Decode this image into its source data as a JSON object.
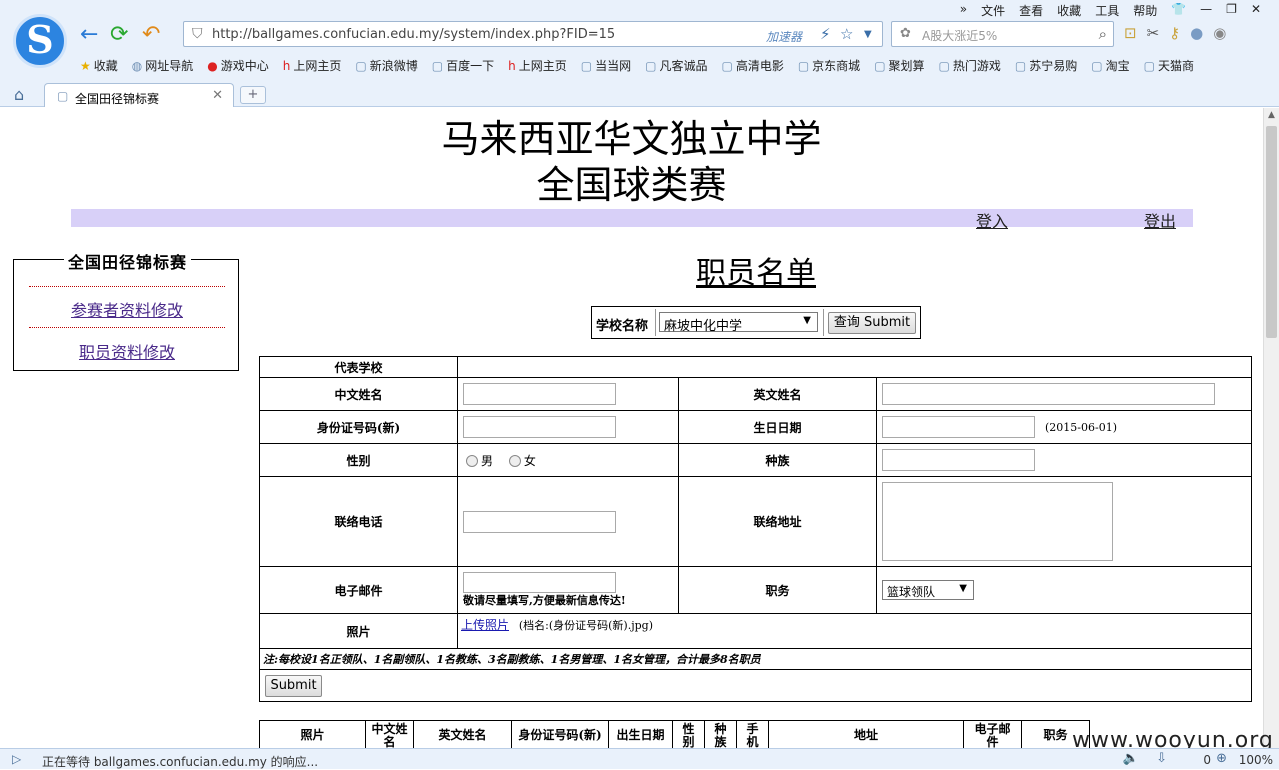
{
  "browser": {
    "menu": [
      "»",
      "文件",
      "查看",
      "收藏",
      "工具",
      "帮助",
      "👕",
      "—",
      "❐",
      "✕"
    ],
    "url": "http://ballgames.confucian.edu.my/system/index.php?FID=15",
    "accelerator": "加速器",
    "search_placeholder": "A股大涨近5%",
    "bookmarks": [
      "收藏",
      "网址导航",
      "游戏中心",
      "上网主页",
      "新浪微博",
      "百度一下",
      "上网主页",
      "当当网",
      "凡客诚品",
      "高清电影",
      "京东商城",
      "聚划算",
      "热门游戏",
      "苏宁易购",
      "淘宝",
      "天猫商"
    ],
    "tab_title": "全国田径锦标赛",
    "status_text": "正在等待 ballgames.confucian.edu.my 的响应...",
    "zoom": "100%",
    "status_count": "0"
  },
  "header": {
    "title_line1": "马来西亚华文独立中学",
    "title_line2": "全国球类赛",
    "login": "登入",
    "logout": "登出"
  },
  "sidebar": {
    "legend": "全国田径锦标赛",
    "links": [
      "参赛者资料修改",
      "职员资料修改"
    ]
  },
  "main": {
    "title": "职员名单",
    "school_label": "学校名称",
    "school_value": "麻坡中化中学",
    "query_button": "查询 Submit"
  },
  "form": {
    "rep_school": "代表学校",
    "chinese_name": "中文姓名",
    "english_name": "英文姓名",
    "ic_number": "身份证号码(新)",
    "birthday": "生日日期",
    "birthday_hint": "(2015-06-01)",
    "gender": "性别",
    "male": "男",
    "female": "女",
    "race": "种族",
    "phone": "联络电话",
    "address": "联络地址",
    "email": "电子邮件",
    "email_hint": "敬请尽量填写,方便最新信息传达!",
    "position": "职务",
    "position_value": "篮球领队",
    "photo": "照片",
    "upload_link": "上传照片",
    "upload_hint": "(档名:(身份证号码(新).jpg)",
    "note": "注:每校设1名正领队、1名副领队、1名教练、3名副教练、1名男管理、1名女管理，合计最多8名职员",
    "submit": "Submit"
  },
  "list_headers": [
    "照片",
    "中文姓名",
    "英文姓名",
    "身份证号码(新)",
    "出生日期",
    "性别",
    "种族",
    "手机",
    "地址",
    "电子邮件",
    "职务"
  ],
  "watermark": "www.wooyun.org"
}
